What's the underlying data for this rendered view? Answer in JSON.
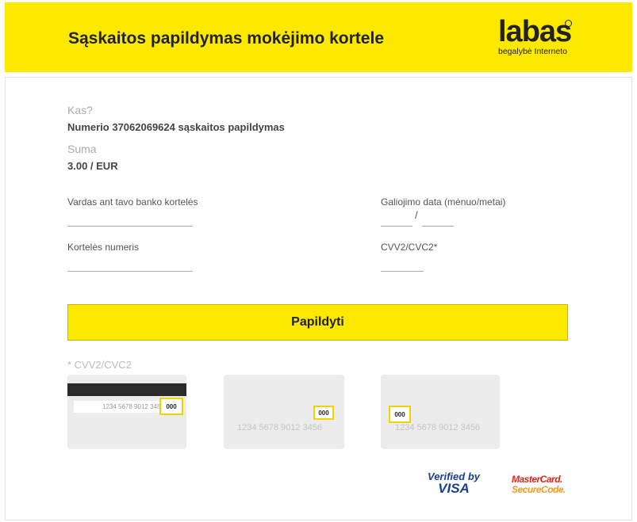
{
  "header": {
    "title": "Sąskaitos papildymas mokėjimo kortele",
    "logo_word": "labas",
    "logo_tagline": "begalybė Interneto"
  },
  "summary": {
    "who_label": "Kas?",
    "who_value": "Numerio 37062069624 sąskaitos papildymas",
    "sum_label": "Suma",
    "sum_value": "3.00 / EUR"
  },
  "form": {
    "cardholder_label": "Vardas ant tavo banko kortelės",
    "card_number_label": "Kortelės numeris",
    "expiry_label": "Galiojimo data (mėnuo/metai)",
    "expiry_separator": "/",
    "cvv_label": "CVV2/CVC2*",
    "submit_label": "Papildyti"
  },
  "cvv_help": {
    "title": "* CVV2/CVC2",
    "card_number": "1234 5678 9012 3456",
    "cvv_code": "000"
  },
  "badges": {
    "visa_line1": "Verified by",
    "visa_line2": "VISA",
    "mc_line1": "MasterCard.",
    "mc_line2": "SecureCode."
  },
  "colors": {
    "accent_yellow": "#fde800",
    "cvv_highlight": "#f0d400"
  }
}
